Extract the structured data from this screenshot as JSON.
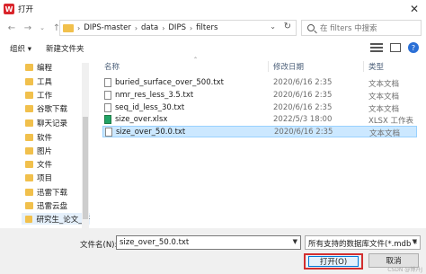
{
  "window": {
    "title": "打开",
    "app_icon": "W"
  },
  "nav": {
    "crumbs": [
      "DIPS-master",
      "data",
      "DIPS",
      "filters"
    ],
    "search_placeholder": "在 filters 中搜索"
  },
  "toolbar": {
    "organize": "组织 ▾",
    "new_folder": "新建文件夹"
  },
  "sidebar": {
    "items": [
      {
        "label": "编程"
      },
      {
        "label": "工具"
      },
      {
        "label": "工作"
      },
      {
        "label": "谷歌下载"
      },
      {
        "label": "聊天记录"
      },
      {
        "label": "软件"
      },
      {
        "label": "图片"
      },
      {
        "label": "文件"
      },
      {
        "label": "项目"
      },
      {
        "label": "迅雷下载"
      },
      {
        "label": "迅雷云盘"
      },
      {
        "label": "研究生_论文_研"
      }
    ]
  },
  "filelist": {
    "columns": {
      "name": "名称",
      "date": "修改日期",
      "type": "类型"
    },
    "rows": [
      {
        "name": "buried_surface_over_500.txt",
        "date": "2020/6/16 2:35",
        "type": "文本文档",
        "kind": "txt"
      },
      {
        "name": "nmr_res_less_3.5.txt",
        "date": "2020/6/16 2:35",
        "type": "文本文档",
        "kind": "txt"
      },
      {
        "name": "seq_id_less_30.txt",
        "date": "2020/6/16 2:35",
        "type": "文本文档",
        "kind": "txt"
      },
      {
        "name": "size_over.xlsx",
        "date": "2022/5/3 18:00",
        "type": "XLSX 工作表",
        "kind": "xlsx"
      },
      {
        "name": "size_over_50.0.txt",
        "date": "2020/6/16 2:35",
        "type": "文本文档",
        "kind": "txt"
      }
    ]
  },
  "bottom": {
    "filename_label": "文件名(N):",
    "filename_value": "size_over_50.0.txt",
    "filter_value": "所有支持的数据库文件(*.mdb *",
    "open_label": "打开(O)",
    "cancel_label": "取消"
  },
  "watermark": "CSDN @博升J"
}
